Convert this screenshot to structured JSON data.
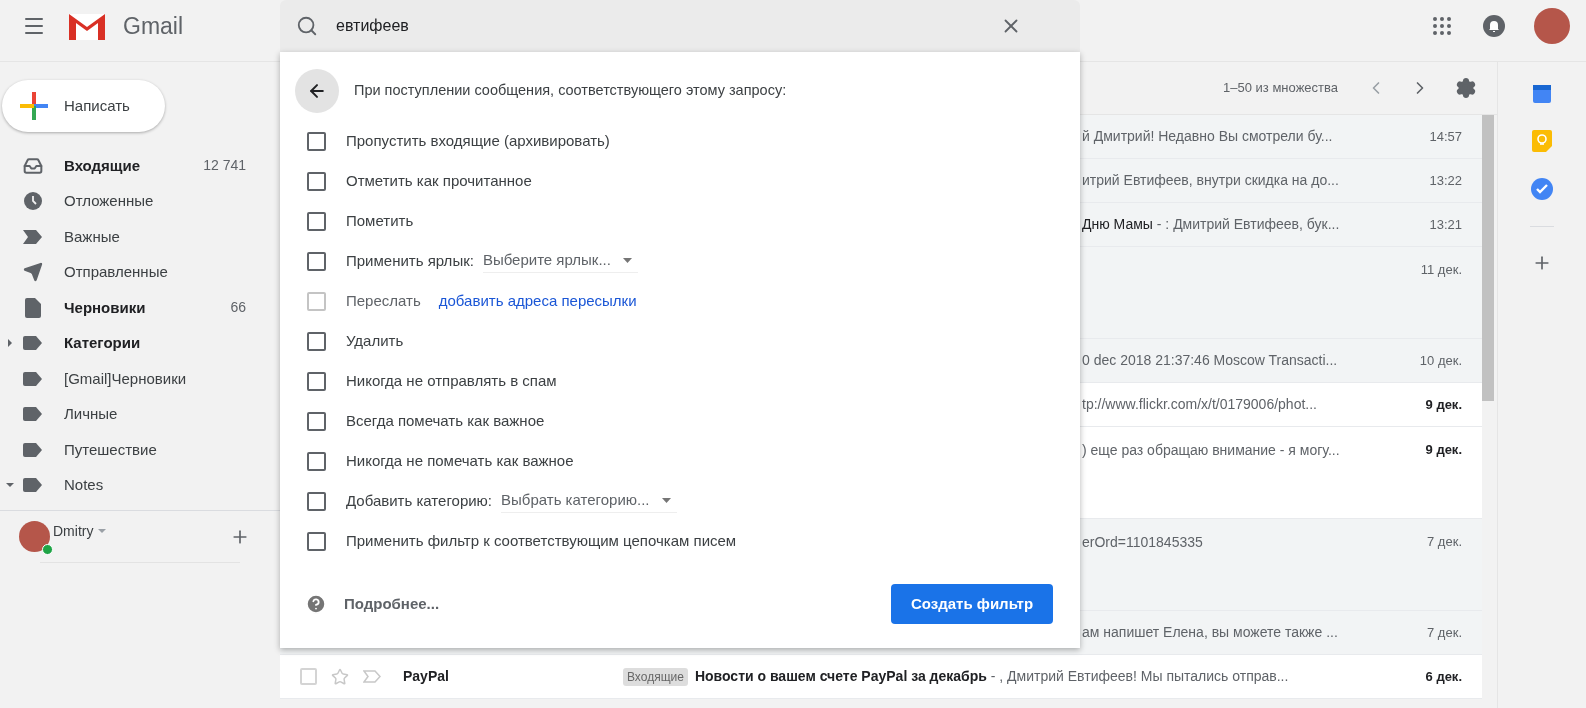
{
  "header": {
    "logo_text": "Gmail",
    "search": {
      "value": "евтифеев"
    }
  },
  "compose": {
    "label": "Написать"
  },
  "sidebar": {
    "items": [
      {
        "kind": "inbox",
        "label": "Входящие",
        "count": "12 741",
        "unread": true
      },
      {
        "kind": "snoozed",
        "label": "Отложенные",
        "unread": false
      },
      {
        "kind": "important",
        "label": "Важные",
        "unread": false
      },
      {
        "kind": "sent",
        "label": "Отправленные",
        "unread": false
      },
      {
        "kind": "drafts",
        "label": "Черновики",
        "count": "66",
        "unread": true
      },
      {
        "kind": "label",
        "label": "Категории",
        "unread": true,
        "expanded": false
      },
      {
        "kind": "label",
        "label": "[Gmail]Черновики",
        "unread": false
      },
      {
        "kind": "label",
        "label": "Личные",
        "unread": false
      },
      {
        "kind": "label",
        "label": "Путешествие",
        "unread": false
      },
      {
        "kind": "label",
        "label": "Notes",
        "unread": false,
        "expanded": true
      }
    ],
    "account": {
      "name": "Dmitry",
      "online": true
    }
  },
  "toolbar": {
    "range": "1–50 из множества"
  },
  "emails": [
    {
      "kind": "single",
      "unread": false,
      "snippet": "й Дмитрий! Недавно Вы смотрели бу...",
      "date": "14:57"
    },
    {
      "kind": "single",
      "unread": false,
      "snippet": "итрий Евтифеев, внутри скидка на до...",
      "date": "13:22"
    },
    {
      "kind": "single",
      "unread": false,
      "subject": "Дню Мамы",
      "snippet": " - : Дмитрий Евтифеев, бук...",
      "date": "13:21"
    },
    {
      "kind": "attachment",
      "unread": false,
      "date": "11 дек."
    },
    {
      "kind": "single",
      "unread": false,
      "snippet": "0 dec 2018 21:37:46 Moscow Transacti...",
      "date": "10 дек."
    },
    {
      "kind": "single",
      "unread": true,
      "snippet": "tp://www.flickr.com/x/t/0179006/phot...",
      "date": "9 дек."
    },
    {
      "kind": "attachment",
      "unread": true,
      "snippet": ") еще раз обращаю внимание - я могу...",
      "date": "9 дек."
    },
    {
      "kind": "attachment",
      "unread": false,
      "snippet": "erOrd=1101845335",
      "date": "7 дек."
    },
    {
      "kind": "single",
      "unread": false,
      "snippet": "ам напишет Елена, вы можете также ...",
      "date": "7 дек."
    },
    {
      "kind": "full",
      "unread": true,
      "sender": "PayPal",
      "label": "Входящие",
      "subject": "Новости о вашем счете PayPal за декабрь",
      "snippet": " - , Дмитрий Евтифеев! Мы пытались отправ...",
      "date": "6 дек."
    }
  ],
  "filter_dialog": {
    "heading": "При поступлении сообщения, соответствующего этому запросу:",
    "options": [
      {
        "kind": "plain",
        "label": "Пропустить входящие (архивировать)",
        "checked": false,
        "disabled": false
      },
      {
        "kind": "plain",
        "label": "Отметить как прочитанное",
        "checked": false,
        "disabled": false
      },
      {
        "kind": "plain",
        "label": "Пометить",
        "checked": false,
        "disabled": false
      },
      {
        "kind": "select",
        "label": "Применить ярлык:",
        "select": "Выберите ярлык...",
        "checked": false,
        "disabled": false
      },
      {
        "kind": "link",
        "label": "Переслать",
        "link": "добавить адреса пересылки",
        "checked": false,
        "disabled": true
      },
      {
        "kind": "plain",
        "label": "Удалить",
        "checked": false,
        "disabled": false
      },
      {
        "kind": "plain",
        "label": "Никогда не отправлять в спам",
        "checked": false,
        "disabled": false
      },
      {
        "kind": "plain",
        "label": "Всегда помечать как важное",
        "checked": false,
        "disabled": false
      },
      {
        "kind": "plain",
        "label": "Никогда не помечать как важное",
        "checked": false,
        "disabled": false
      },
      {
        "kind": "select",
        "label": "Добавить категорию:",
        "select": "Выбрать категорию...",
        "checked": false,
        "disabled": false
      },
      {
        "kind": "plain",
        "label": "Применить фильтр к соответствующим цепочкам писем",
        "checked": false,
        "disabled": false
      }
    ],
    "help_link": "Подробнее...",
    "submit": "Создать фильтр"
  }
}
